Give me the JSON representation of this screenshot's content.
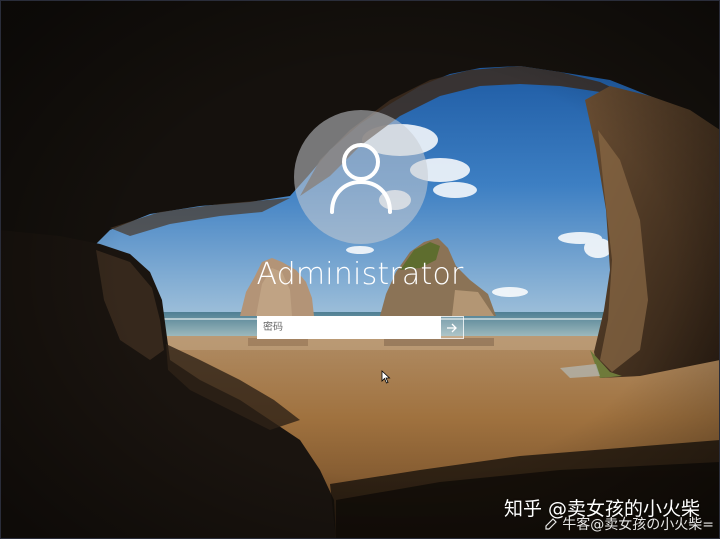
{
  "lock_screen": {
    "username": "Administrator",
    "password_placeholder": "密码",
    "password_value": "",
    "submit_icon": "arrow-right-icon",
    "avatar_icon": "user-icon"
  },
  "watermark": {
    "main_text": "知乎 @卖女孩的小火柴",
    "sub_text": "牛客@卖女孩の小火柴="
  },
  "colors": {
    "sky": "#3f7fc0",
    "sand": "#a77a49",
    "sea": "#6f9fb0",
    "rock_dark": "#1a1410"
  }
}
